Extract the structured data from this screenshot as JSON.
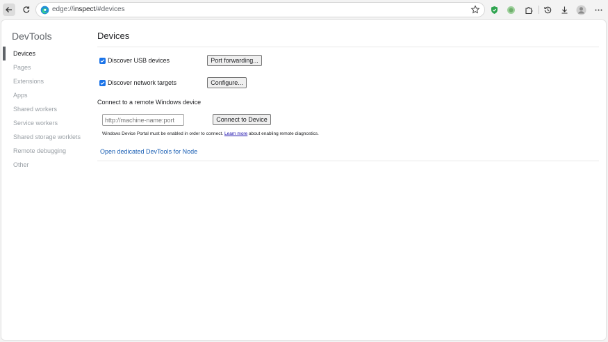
{
  "browser": {
    "url_prefix": "edge://",
    "url_host": "inspect",
    "url_path": "/#devices"
  },
  "sidebar": {
    "title": "DevTools",
    "items": [
      {
        "label": "Devices",
        "active": true
      },
      {
        "label": "Pages"
      },
      {
        "label": "Extensions"
      },
      {
        "label": "Apps"
      },
      {
        "label": "Shared workers"
      },
      {
        "label": "Service workers"
      },
      {
        "label": "Shared storage worklets"
      },
      {
        "label": "Remote debugging"
      },
      {
        "label": "Other"
      }
    ]
  },
  "main": {
    "title": "Devices",
    "usb": {
      "label": "Discover USB devices",
      "checked": true,
      "button": "Port forwarding..."
    },
    "network": {
      "label": "Discover network targets",
      "checked": true,
      "button": "Configure..."
    },
    "remote": {
      "heading": "Connect to a remote Windows device",
      "placeholder": "http://machine-name:port",
      "button": "Connect to Device",
      "note_before": "Windows Device Portal must be enabled in order to connect.",
      "note_link": "Learn more",
      "note_after": "about enabling remote diagnostics."
    },
    "node_link": "Open dedicated DevTools for Node"
  },
  "colors": {
    "accent": "#1a73e8",
    "link": "#1a5fb4"
  }
}
